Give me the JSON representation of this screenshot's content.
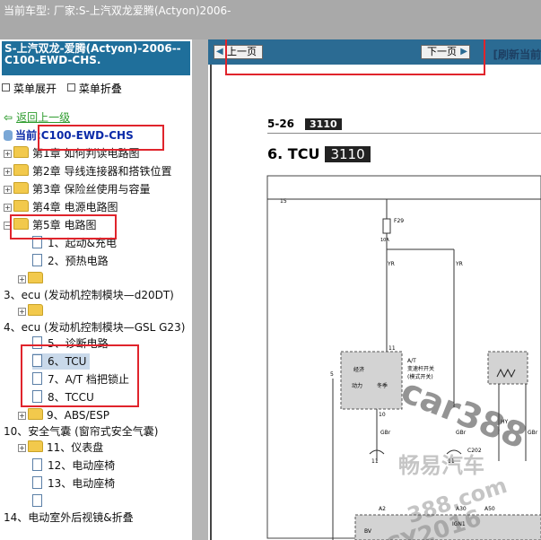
{
  "window": {
    "title": "当前车型:  厂家:S-上汽双龙爱腾(Actyon)2006-"
  },
  "left": {
    "header": "S-上汽双龙-爱腾(Actyon)-2006-- C100-EWD-CHS.",
    "expand_all": "菜单展开",
    "collapse_all": "菜单折叠",
    "back": "返回上一级",
    "current": "当前:C100-EWD-CHS",
    "tree": [
      {
        "label": "第1章 如何判读电路图"
      },
      {
        "label": "第2章 导线连接器和搭铁位置"
      },
      {
        "label": "第3章 保险丝使用与容量"
      },
      {
        "label": "第4章 电源电路图"
      },
      {
        "label": "第5章 电路图"
      },
      {
        "label": "1、起动&充电"
      },
      {
        "label": "2、预热电路"
      },
      {
        "label": ""
      },
      {
        "label": "3、ecu (发动机控制模块—d20DT)"
      },
      {
        "label": ""
      },
      {
        "label": "4、ecu (发动机控制模块—GSL G23)"
      },
      {
        "label": "5、诊断电路"
      },
      {
        "label": "6、TCU"
      },
      {
        "label": "7、A/T 档把锁止"
      },
      {
        "label": "8、TCCU"
      },
      {
        "label": "9、ABS/ESP"
      },
      {
        "label": "10、安全气囊 (窗帘式安全气囊)"
      },
      {
        "label": "11、仪表盘"
      },
      {
        "label": "12、电动座椅"
      },
      {
        "label": "13、电动座椅"
      },
      {
        "label": ""
      },
      {
        "label": "14、电动室外后视镜&折叠"
      }
    ]
  },
  "right": {
    "prev": "上一页",
    "next": "下一页",
    "refresh": "[刷新当前",
    "page_number": "5-26",
    "page_code": "3110",
    "heading": "6. TCU",
    "heading_code": "3110"
  },
  "diagram": {
    "labels": [
      "15",
      "F29",
      "10A",
      "YR",
      "YR",
      "11",
      "经济",
      "动力",
      "冬季",
      "A/T",
      "变速杆开关",
      "(模式开关)",
      "5",
      "10",
      "GBr",
      "GBr",
      "11",
      "11",
      "C202",
      "A2",
      "A30",
      "A50",
      "IGN1",
      "BV",
      "HY",
      "GBr"
    ]
  },
  "watermark": [
    "car388",
    "畅易汽车",
    "388.com",
    "CY2016"
  ]
}
